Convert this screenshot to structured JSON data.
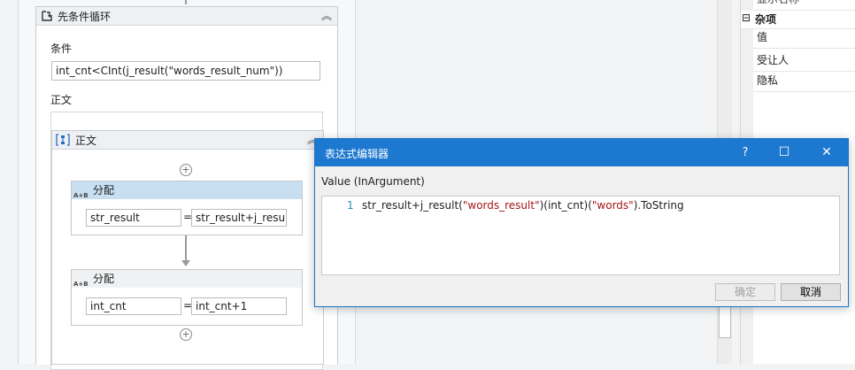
{
  "designer": {
    "while_activity": {
      "title": "先条件循环",
      "condition_label": "条件",
      "condition_value": "int_cnt<CInt(j_result(\"words_result_num\"))",
      "body_label": "正文"
    },
    "sequence": {
      "title": "正文",
      "assign1": {
        "title": "分配",
        "badge": "A+B",
        "to": "str_result",
        "eq": "=",
        "value": "str_result+j_resul"
      },
      "assign2": {
        "title": "分配",
        "badge": "A+B",
        "to": "int_cnt",
        "eq": "=",
        "value": "int_cnt+1"
      }
    }
  },
  "properties": {
    "partial_top": "显示名称",
    "category_toggle": "⊟",
    "category": "杂项",
    "rows": [
      "值",
      "受让人",
      "隐私"
    ]
  },
  "dialog": {
    "title": "表达式编辑器",
    "help": "?",
    "maximize": "☐",
    "close": "✕",
    "arg_label": "Value (InArgument)",
    "line_number": "1",
    "code_parts": [
      "str_result+j_result(",
      "\"words_result\"",
      ")(int_cnt)(",
      "\"words\"",
      ").ToString"
    ],
    "ok_label": "确定",
    "cancel_label": "取消"
  },
  "colors": {
    "dialog_accent": "#1d78d0",
    "string_literal": "#a31515",
    "line_number": "#2b91af"
  }
}
